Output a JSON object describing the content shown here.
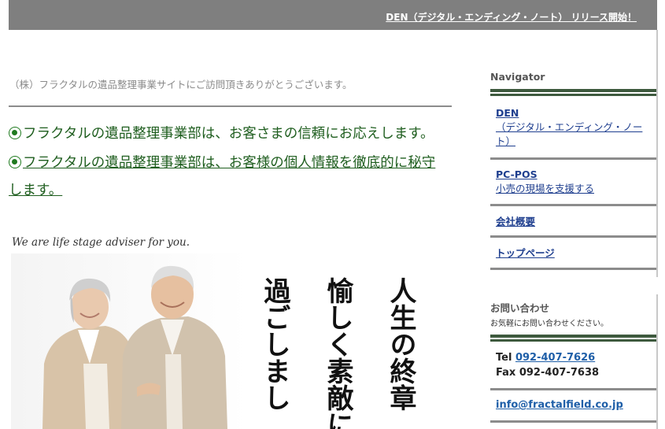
{
  "header": {
    "announcement_link": "DEN（デジタル・エンディング・ノート） リリース開始！"
  },
  "main": {
    "greeting": "（株）フラクタルの遺品整理事業サイトにご訪問頂きありがとうございます。",
    "message1": "フラクタルの遺品整理事業部は、お客さまの信頼にお応えします。",
    "message2_line1": "フラクタルの遺品整理事業部は、お客様の個人情報を徹底的に秘守",
    "message2_line2": "します。",
    "tagline": "We are life stage adviser for you.",
    "calligraphy": [
      "人生の終章",
      "愉しく素敵に",
      "過ごしまし"
    ]
  },
  "sidebar": {
    "nav_heading": "Navigator",
    "items": [
      {
        "title": "DEN",
        "desc": "（デジタル・エンディング・ノート）"
      },
      {
        "title": "PC-POS",
        "desc": "小売の現場を支援する"
      },
      {
        "title": "会社概要"
      },
      {
        "title": "トップページ"
      }
    ],
    "contact_heading": "お問い合わせ",
    "contact_sub": "お気軽にお問い合わせください。",
    "tel_label": "Tel",
    "tel": "092-407-7626",
    "fax_label": "Fax",
    "fax": "092-407-7638",
    "email": "info@fractalfield.co.jp"
  },
  "colors": {
    "topbar": "#7f7f7f",
    "message_green": "#1f5e1f",
    "link_blue": "#1f3f8f",
    "rule_green": "#3e5a3e"
  }
}
